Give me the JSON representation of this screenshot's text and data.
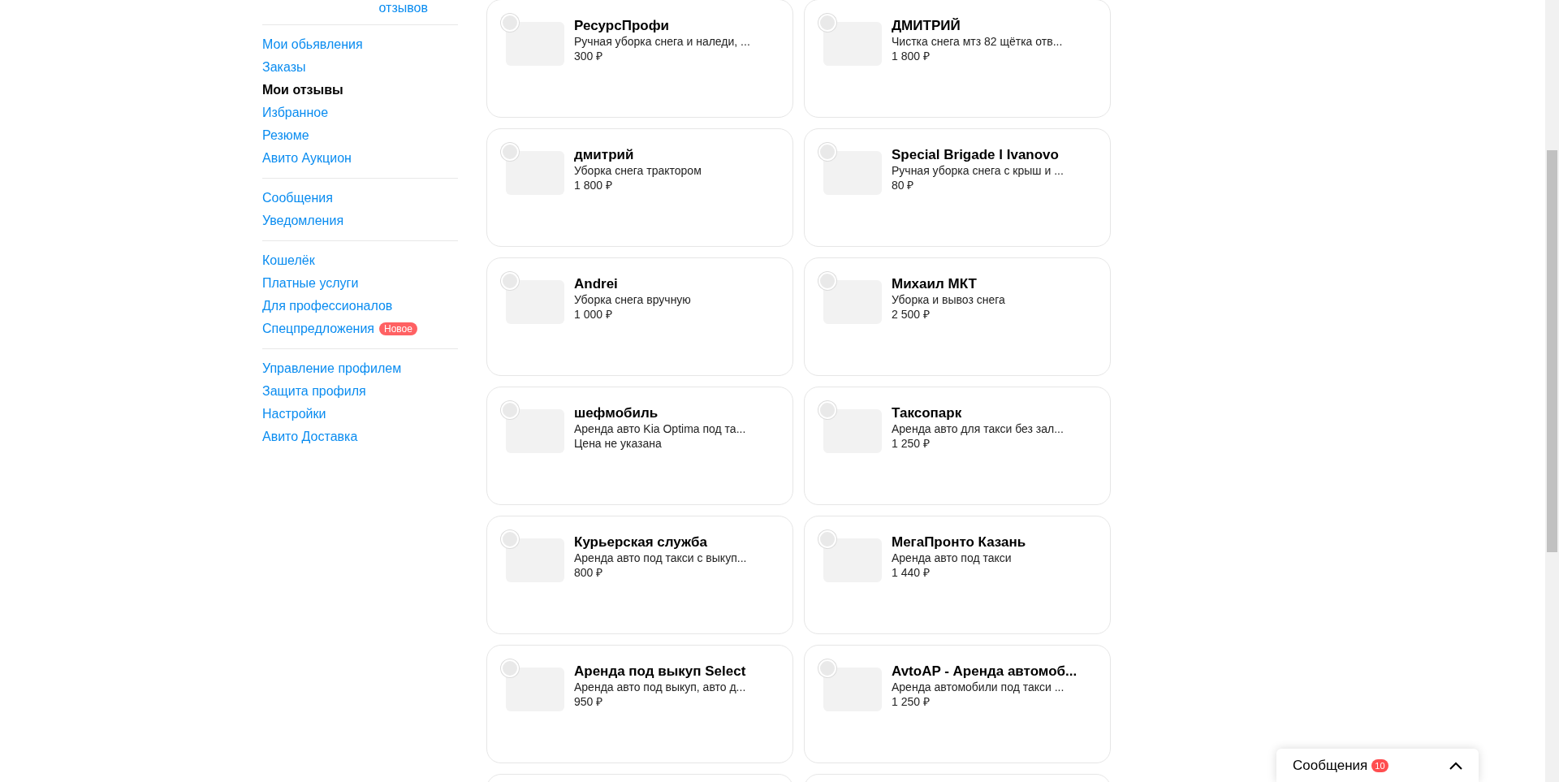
{
  "sidebar": {
    "header_link": "отзывов",
    "sections": [
      {
        "items": [
          {
            "label": "Мои обьявления",
            "selected": false
          },
          {
            "label": "Заказы",
            "selected": false
          },
          {
            "label": "Мои отзывы",
            "selected": true
          },
          {
            "label": "Избранное",
            "selected": false
          },
          {
            "label": "Резюме",
            "selected": false
          },
          {
            "label": "Авито Аукцион",
            "selected": false
          }
        ]
      },
      {
        "items": [
          {
            "label": "Сообщения",
            "selected": false
          },
          {
            "label": "Уведомления",
            "selected": false
          }
        ]
      },
      {
        "items": [
          {
            "label": "Кошелёк",
            "selected": false
          },
          {
            "label": "Платные услуги",
            "selected": false
          },
          {
            "label": "Для профессионалов",
            "selected": false
          },
          {
            "label": "Спецпредложения",
            "selected": false,
            "badge": "Новое"
          }
        ]
      },
      {
        "items": [
          {
            "label": "Управление профилем",
            "selected": false
          },
          {
            "label": "Защита профиля",
            "selected": false
          },
          {
            "label": "Настройки",
            "selected": false
          },
          {
            "label": "Авито Доставка",
            "selected": false
          }
        ]
      }
    ]
  },
  "cards": [
    {
      "title": "РесурсПрофи",
      "subtitle": "Ручная уборка снега и наледи, ...",
      "price": "300 ₽"
    },
    {
      "title": "ДМИТРИЙ",
      "subtitle": "Чистка снега мтз 82 щётка отв...",
      "price": "1 800 ₽"
    },
    {
      "title": "дмитрий",
      "subtitle": "Уборка снега трактором",
      "price": "1 800 ₽"
    },
    {
      "title": "Special Brigade l Ivanovo",
      "subtitle": "Ручная уборка снега с крыш и ...",
      "price": "80 ₽"
    },
    {
      "title": "Andrei",
      "subtitle": "Уборка снега вручную",
      "price": "1 000 ₽"
    },
    {
      "title": "Михаил МКТ",
      "subtitle": "Уборка и вывоз снега",
      "price": "2 500 ₽"
    },
    {
      "title": "шефмобиль",
      "subtitle": "Аренда авто Kia Optima под та...",
      "price": "Цена не указана"
    },
    {
      "title": "Таксопарк",
      "subtitle": "Аренда авто для такси без зал...",
      "price": "1 250 ₽"
    },
    {
      "title": "Курьерская служба",
      "subtitle": "Аренда авто под такси с выкуп...",
      "price": "800 ₽"
    },
    {
      "title": "МегаПронто Казань",
      "subtitle": "Аренда авто под такси",
      "price": "1 440 ₽"
    },
    {
      "title": "Аренда под выкуп Select",
      "subtitle": "Аренда авто под выкуп, авто д...",
      "price": "950 ₽"
    },
    {
      "title": "AvtoAP - Аренда автомоб...",
      "subtitle": "Аренда автомобили под такси ...",
      "price": "1 250 ₽"
    }
  ],
  "messages_widget": {
    "label": "Сообщения",
    "count": "10"
  }
}
